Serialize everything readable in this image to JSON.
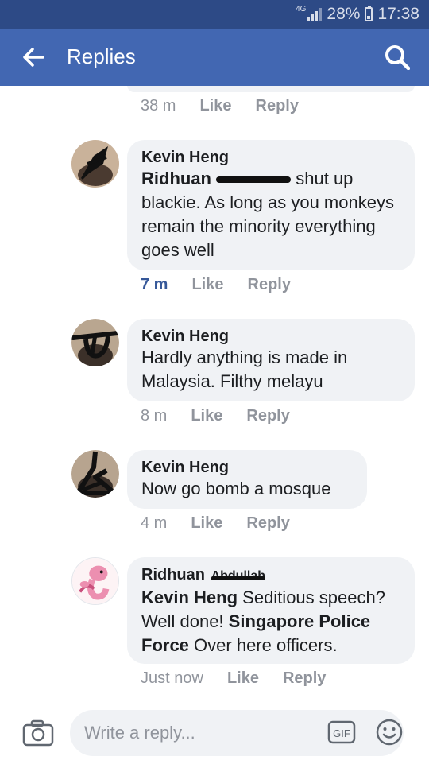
{
  "status": {
    "network": "4G",
    "battery": "28%",
    "time": "17:38"
  },
  "header": {
    "title": "Replies"
  },
  "previous": {
    "time": "38 m",
    "like": "Like",
    "reply": "Reply"
  },
  "comments": [
    {
      "author": "Kevin Heng",
      "mention": "Ridhuan",
      "text": "shut up blackie. As long as you monkeys remain the minority everything goes well",
      "time": "7 m",
      "like": "Like",
      "reply": "Reply"
    },
    {
      "author": "Kevin Heng",
      "text": "Hardly anything is made in Malaysia. Filthy melayu",
      "time": "8 m",
      "like": "Like",
      "reply": "Reply"
    },
    {
      "author": "Kevin Heng",
      "text": "Now go bomb a mosque",
      "time": "4 m",
      "like": "Like",
      "reply": "Reply"
    },
    {
      "author": "Ridhuan",
      "author_struck": "Abdullah",
      "mention": "Kevin Heng",
      "text_1": "Seditious speech? Well done!",
      "mention_2": "Singapore Police Force",
      "text_2": "Over here officers.",
      "time": "Just now",
      "like": "Like",
      "reply": "Reply"
    }
  ],
  "composer": {
    "placeholder": "Write a reply...",
    "gif": "GIF"
  },
  "icons": {
    "back": "arrow-left-icon",
    "search": "search-icon",
    "camera": "camera-icon",
    "gif": "gif-icon",
    "emoji": "smiley-icon"
  },
  "colors": {
    "appbar": "#4267b2",
    "statusbar": "#2d4a86",
    "bubble": "#f0f2f5",
    "link": "#365899"
  }
}
